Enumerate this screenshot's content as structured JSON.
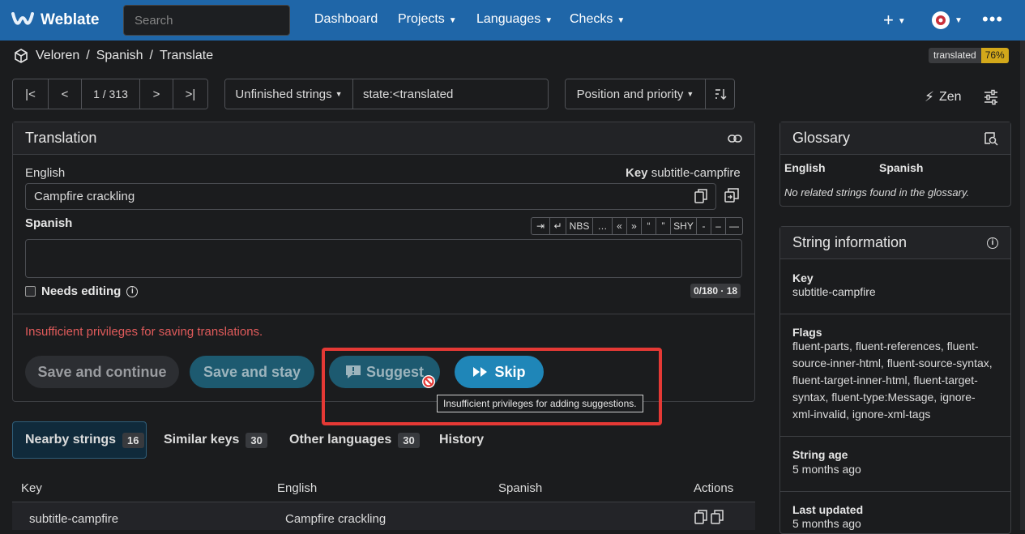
{
  "navbar": {
    "brand": "Weblate",
    "search_placeholder": "Search",
    "links": [
      "Dashboard",
      "Projects",
      "Languages",
      "Checks"
    ]
  },
  "breadcrumb": [
    "Veloren",
    "Spanish",
    "Translate"
  ],
  "status_badge": {
    "label": "translated",
    "percent": "76%"
  },
  "toolbar": {
    "position": "1 / 313",
    "filter_label": "Unfinished strings",
    "query": "state:<translated",
    "sort_label": "Position and priority",
    "zen_label": "Zen"
  },
  "translation": {
    "title": "Translation",
    "source_lang": "English",
    "key_label": "Key",
    "key_value": "subtitle-campfire",
    "source_text": "Campfire crackling",
    "target_lang": "Spanish",
    "special_chars": [
      "⇥",
      "↵",
      "NBS",
      "…",
      "«",
      "»",
      "“",
      "”",
      "SHY",
      "-",
      "–",
      "—"
    ],
    "target_text": "",
    "needs_editing": "Needs editing",
    "counter": "0/180 · 18",
    "error": "Insufficient privileges for saving translations.",
    "buttons": {
      "save_continue": "Save and continue",
      "save_stay": "Save and stay",
      "suggest": "Suggest",
      "skip": "Skip"
    },
    "tooltip": "Insufficient privileges for adding suggestions."
  },
  "tabs": [
    {
      "label": "Nearby strings",
      "count": "16"
    },
    {
      "label": "Similar keys",
      "count": "30"
    },
    {
      "label": "Other languages",
      "count": "30"
    },
    {
      "label": "History",
      "count": ""
    }
  ],
  "table": {
    "headers": [
      "Key",
      "English",
      "Spanish",
      "Actions"
    ],
    "rows": [
      {
        "key": "subtitle-campfire",
        "english": "Campfire crackling",
        "spanish": ""
      }
    ]
  },
  "glossary": {
    "title": "Glossary",
    "col_source": "English",
    "col_target": "Spanish",
    "empty": "No related strings found in the glossary."
  },
  "string_info": {
    "title": "String information",
    "key_label": "Key",
    "key_value": "subtitle-campfire",
    "flags_label": "Flags",
    "flags_value": "fluent-parts, fluent-references, fluent-source-inner-html, fluent-source-syntax, fluent-target-inner-html, fluent-target-syntax, fluent-type:Message, ignore-xml-invalid, ignore-xml-tags",
    "age_label": "String age",
    "age_value": "5 months ago",
    "updated_label": "Last updated",
    "updated_value": "5 months ago"
  },
  "colors": {
    "navbar": "#1f66a8",
    "skip": "#1f86b8",
    "error": "#e05b5b",
    "highlight": "#e53935",
    "badge": "#d3a81a"
  }
}
